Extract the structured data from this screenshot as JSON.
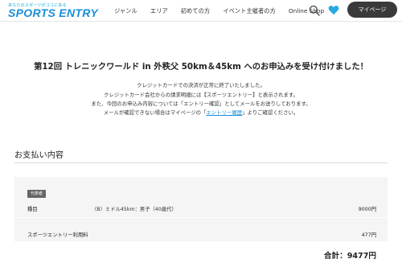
{
  "header": {
    "logo_tagline": "あなたのスポーツがココにある",
    "logo_text": "SPORTS ENTRY",
    "nav": [
      "ジャンル",
      "エリア",
      "初めての方",
      "イベント主催者の方",
      "Online Shop"
    ],
    "mypage_label": "マイページ",
    "accent_color": "#1a8fd8",
    "icons": [
      "search-icon",
      "heart-icon"
    ]
  },
  "confirmation": {
    "title": "第12回 トレニックワールド in 外秩父 50km＆45km へのお申込みを受け付けました！",
    "line1": "クレジットカードでの決済が正常に終了いたしました。",
    "line2": "クレジットカード会社からの請求明細には【スポーツエントリー】と表示されます。",
    "line3": "また、今回のお申込み内容については「エントリー確認」としてメールをお送りしております。",
    "line4_pre": "メールが確認できない場合はマイページの「",
    "line4_link": "エントリー履歴",
    "line4_post": "」よりご確認ください。"
  },
  "payment": {
    "section_title": "お支払い内容",
    "badge": "代表者",
    "item_label": "種目",
    "item_value": "（B）ミドル45km：男子（40歳代）",
    "item_amount": "9000円",
    "fee_label": "スポーツエントリー利用料",
    "fee_amount": "477円",
    "total": "合計：9477円"
  }
}
